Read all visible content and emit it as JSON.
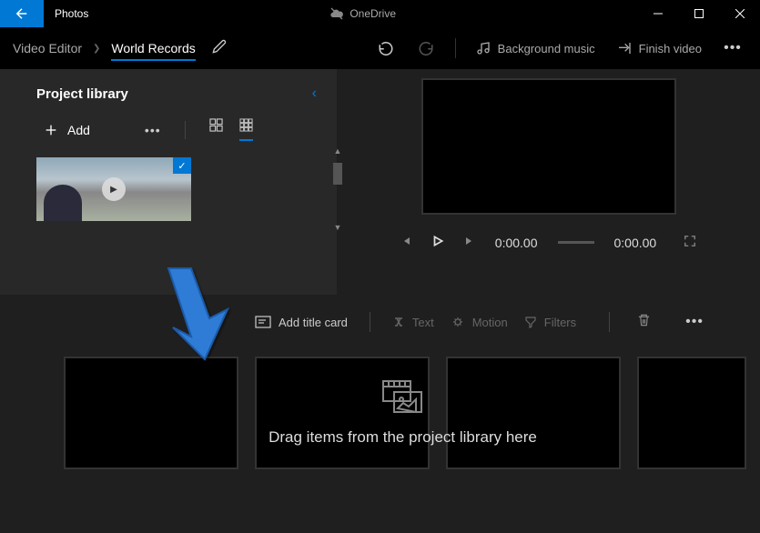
{
  "titlebar": {
    "app_name": "Photos",
    "cloud_label": "OneDrive"
  },
  "toolbar": {
    "breadcrumb_root": "Video Editor",
    "breadcrumb_project": "World Records",
    "bg_music": "Background music",
    "finish": "Finish video"
  },
  "library": {
    "title": "Project library",
    "add_label": "Add"
  },
  "preview": {
    "time_current": "0:00.00",
    "time_total": "0:00.00"
  },
  "storyboard": {
    "add_title_card": "Add title card",
    "text": "Text",
    "motion": "Motion",
    "filters": "Filters",
    "placeholder": "Drag items from the project library here"
  }
}
